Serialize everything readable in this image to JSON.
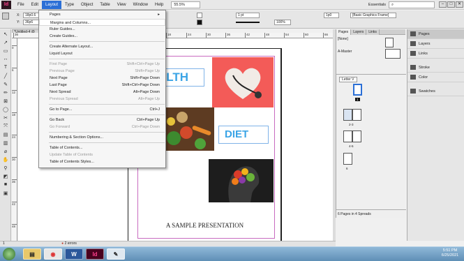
{
  "menubar": {
    "app_logo": "Id",
    "items": [
      "File",
      "Edit",
      "Layout",
      "Type",
      "Object",
      "Table",
      "View",
      "Window",
      "Help"
    ],
    "zoom": "55.5%",
    "workspace": "Essentials",
    "search_placeholder": "",
    "win_min": "–",
    "win_max": "□",
    "win_close": "✕"
  },
  "controlbar": {
    "x_label": "X:",
    "x_value": "18p0.6",
    "y_label": "Y:",
    "y_value": "36p6",
    "stroke_weight": "1 pt",
    "percent": "100%",
    "spacing": "1p0",
    "frame_style": "[Basic Graphics Frame]"
  },
  "document": {
    "tab_label": "*Untitled-4 @",
    "ruler_h": [
      "36",
      "18",
      "24",
      "30",
      "36",
      "42",
      "48",
      "54",
      "60",
      "66"
    ],
    "ruler_v": [
      "0",
      "6",
      "12",
      "18",
      "24",
      "30",
      "36",
      "42",
      "48"
    ]
  },
  "page_content": {
    "health_text": "ALTH",
    "diet_text": "DIET",
    "caption": "A SAMPLE PRESENTATION"
  },
  "layout_menu": {
    "items": [
      {
        "label": "Pages",
        "shortcut": "▸",
        "disabled": false,
        "highlight": false
      },
      {
        "label": "Margins and Columns...",
        "shortcut": "",
        "disabled": false,
        "highlight": true
      },
      {
        "label": "Ruler Guides...",
        "shortcut": "",
        "disabled": false,
        "highlight": false
      },
      {
        "label": "Create Guides...",
        "shortcut": "",
        "disabled": false,
        "highlight": false
      },
      {
        "label": "Create Alternate Layout...",
        "shortcut": "",
        "disabled": false,
        "highlight": false
      },
      {
        "label": "Liquid Layout",
        "shortcut": "",
        "disabled": false,
        "highlight": false
      },
      {
        "label": "First Page",
        "shortcut": "Shift+Ctrl+Page Up",
        "disabled": true,
        "highlight": false
      },
      {
        "label": "Previous Page",
        "shortcut": "Shift+Page Up",
        "disabled": true,
        "highlight": false
      },
      {
        "label": "Next Page",
        "shortcut": "Shift+Page Down",
        "disabled": false,
        "highlight": false
      },
      {
        "label": "Last Page",
        "shortcut": "Shift+Ctrl+Page Down",
        "disabled": false,
        "highlight": false
      },
      {
        "label": "Next Spread",
        "shortcut": "Alt+Page Down",
        "disabled": false,
        "highlight": false
      },
      {
        "label": "Previous Spread",
        "shortcut": "Alt+Page Up",
        "disabled": true,
        "highlight": false
      },
      {
        "label": "Go to Page...",
        "shortcut": "Ctrl+J",
        "disabled": false,
        "highlight": false
      },
      {
        "label": "Go Back",
        "shortcut": "Ctrl+Page Up",
        "disabled": false,
        "highlight": false
      },
      {
        "label": "Go Forward",
        "shortcut": "Ctrl+Page Down",
        "disabled": true,
        "highlight": false
      },
      {
        "label": "Numbering & Section Options...",
        "shortcut": "",
        "disabled": false,
        "highlight": false
      },
      {
        "label": "Table of Contents...",
        "shortcut": "",
        "disabled": false,
        "highlight": false
      },
      {
        "label": "Update Table of Contents",
        "shortcut": "",
        "disabled": true,
        "highlight": false
      },
      {
        "label": "Table of Contents Styles...",
        "shortcut": "",
        "disabled": false,
        "highlight": false
      }
    ]
  },
  "pages_panel": {
    "tabs": [
      "Pages",
      "Layers",
      "Links"
    ],
    "none_label": "[None]",
    "master_label": "A-Master",
    "size_label": "Letter V",
    "spread_labels": [
      "1",
      "2-3",
      "4-5",
      "6"
    ],
    "footer": "6 Pages in 4 Spreads"
  },
  "right_panels": {
    "items": [
      "Pages",
      "Layers",
      "Links",
      "Stroke",
      "Color",
      "Swatches"
    ]
  },
  "statusbar": {
    "page": "1",
    "errors": "2 errors"
  },
  "taskbar": {
    "time": "5:51 PM",
    "date": "6/25/2021",
    "id_app": "Id",
    "word_app": "W"
  },
  "colors": {
    "menu_highlight": "#2b6fd6",
    "margin_guide": "#c86bc0",
    "diet_text": "#3aa4e6",
    "heart_bg": "#f35b58"
  }
}
